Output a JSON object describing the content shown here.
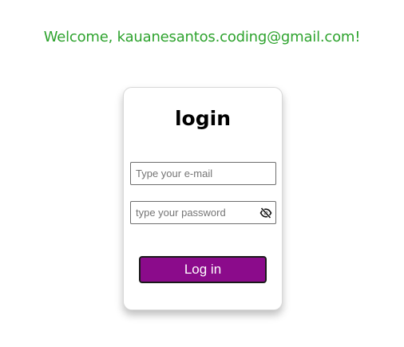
{
  "header": {
    "welcome_text": "Welcome, kauanesantos.coding@gmail.com!",
    "welcome_color": "#2ea32e"
  },
  "login_card": {
    "title": "login",
    "email": {
      "value": "",
      "placeholder": "Type your e-mail"
    },
    "password": {
      "value": "",
      "placeholder": "type your password",
      "toggle_icon": "eye-slash-icon"
    },
    "submit_label": "Log in",
    "submit_color": "#8b0b8b"
  }
}
